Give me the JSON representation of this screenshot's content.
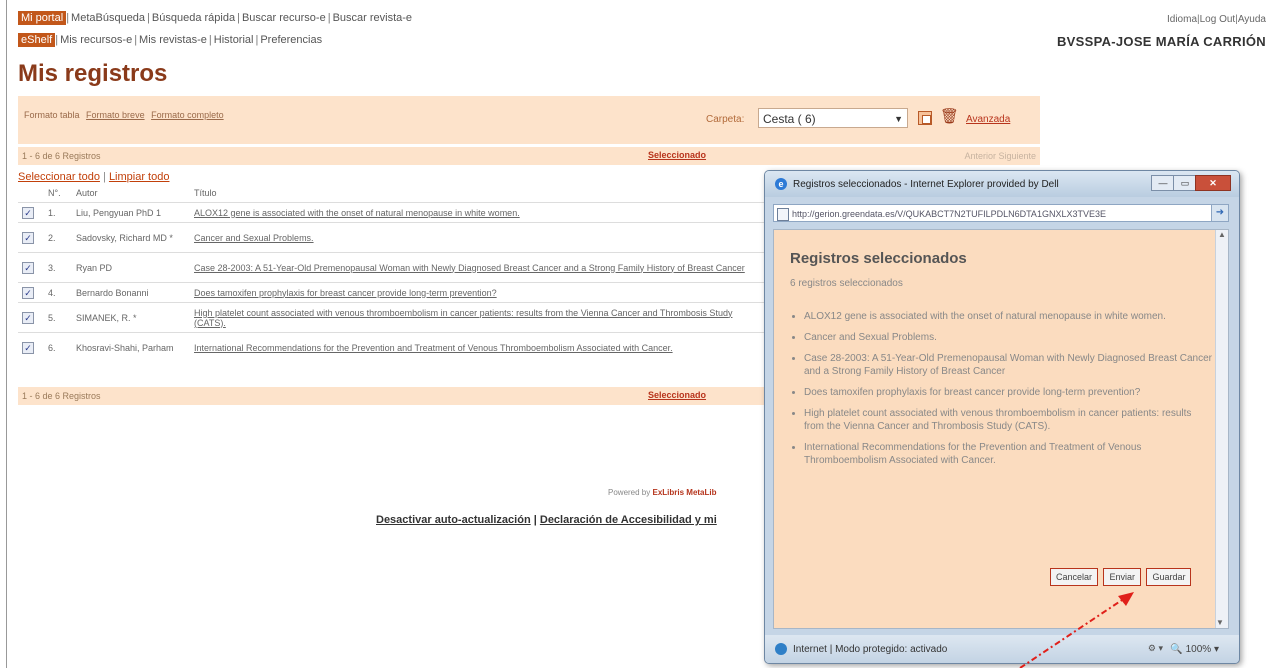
{
  "nav": {
    "row1": [
      "Mi portal",
      "MetaBúsqueda",
      "Búsqueda rápida",
      "Buscar recurso-e",
      "Buscar revista-e"
    ],
    "row2": [
      "eShelf",
      "Mis recursos-e",
      "Mis revistas-e",
      "Historial",
      "Preferencias"
    ]
  },
  "top_right": {
    "idioma": "Idioma",
    "logout": "Log Out",
    "ayuda": "Ayuda"
  },
  "user": "BVSSPA-JOSE MARÍA CARRIÓN",
  "page_title": "Mis registros",
  "toolbar": {
    "formats": [
      "Formato tabla",
      "Formato breve",
      "Formato completo"
    ],
    "carpeta_label": "Carpeta:",
    "carpeta_value": "Cesta ( 6)",
    "avanzada": "Avanzada"
  },
  "count": {
    "text": "1 - 6 de 6 Registros",
    "seleccionado": "Seleccionado",
    "prev_next": "Anterior  Siguiente"
  },
  "select_links": {
    "select_all": "Seleccionar todo",
    "clear_all": "Limpiar todo"
  },
  "table": {
    "headers": [
      "N°.",
      "Autor",
      "Título"
    ],
    "rows": [
      {
        "n": "1.",
        "author": "Liu, Pengyuan PhD 1",
        "title": "ALOX12 gene is associated with the onset of natural menopause in white women."
      },
      {
        "n": "2.",
        "author": "Sadovsky, Richard MD *",
        "title": "Cancer and Sexual Problems."
      },
      {
        "n": "3.",
        "author": "Ryan PD",
        "title": "Case 28-2003: A 51-Year-Old Premenopausal Woman with Newly Diagnosed Breast Cancer and a Strong Family History of Breast Cancer"
      },
      {
        "n": "4.",
        "author": "Bernardo Bonanni",
        "title": "Does tamoxifen prophylaxis for breast cancer provide long-term prevention?"
      },
      {
        "n": "5.",
        "author": "SIMANEK, R. *",
        "title": "High platelet count associated with venous thromboembolism in cancer patients: results from the Vienna Cancer and Thrombosis Study (CATS)."
      },
      {
        "n": "6.",
        "author": "Khosravi-Shahi, Parham",
        "title": "International Recommendations for the Prevention and Treatment of Venous Thromboembolism Associated with Cancer."
      }
    ]
  },
  "powered": {
    "text": "Powered by",
    "brand": "ExLibris MetaLib"
  },
  "footer": {
    "link1": "Desactivar auto-actualización",
    "link2": "Declaración de Accesibilidad y mi"
  },
  "popup": {
    "window_title": "Registros seleccionados - Internet Explorer provided by Dell",
    "address": "http://gerion.greendata.es/V/QUKABCT7N2TUFILPDLN6DTA1GNXLX3TVE3E",
    "heading": "Registros seleccionados",
    "subtitle": "6 registros seleccionados",
    "items": [
      "ALOX12 gene is associated with the onset of natural menopause in white women.",
      "Cancer and Sexual Problems.",
      "Case 28-2003: A 51-Year-Old Premenopausal Woman with Newly Diagnosed Breast Cancer and a Strong Family History of Breast Cancer",
      "Does tamoxifen prophylaxis for breast cancer provide long-term prevention?",
      "High platelet count associated with venous thromboembolism in cancer patients: results from the Vienna Cancer and Thrombosis Study (CATS).",
      "International Recommendations for the Prevention and Treatment of Venous Thromboembolism Associated with Cancer."
    ],
    "buttons": {
      "cancel": "Cancelar",
      "send": "Enviar",
      "save": "Guardar"
    },
    "status": "Internet | Modo protegido: activado",
    "zoom": "100%"
  },
  "colors": {
    "accent": "#c2571a",
    "peach": "#fde3cb",
    "annotation_arrow": "#e0201a"
  }
}
